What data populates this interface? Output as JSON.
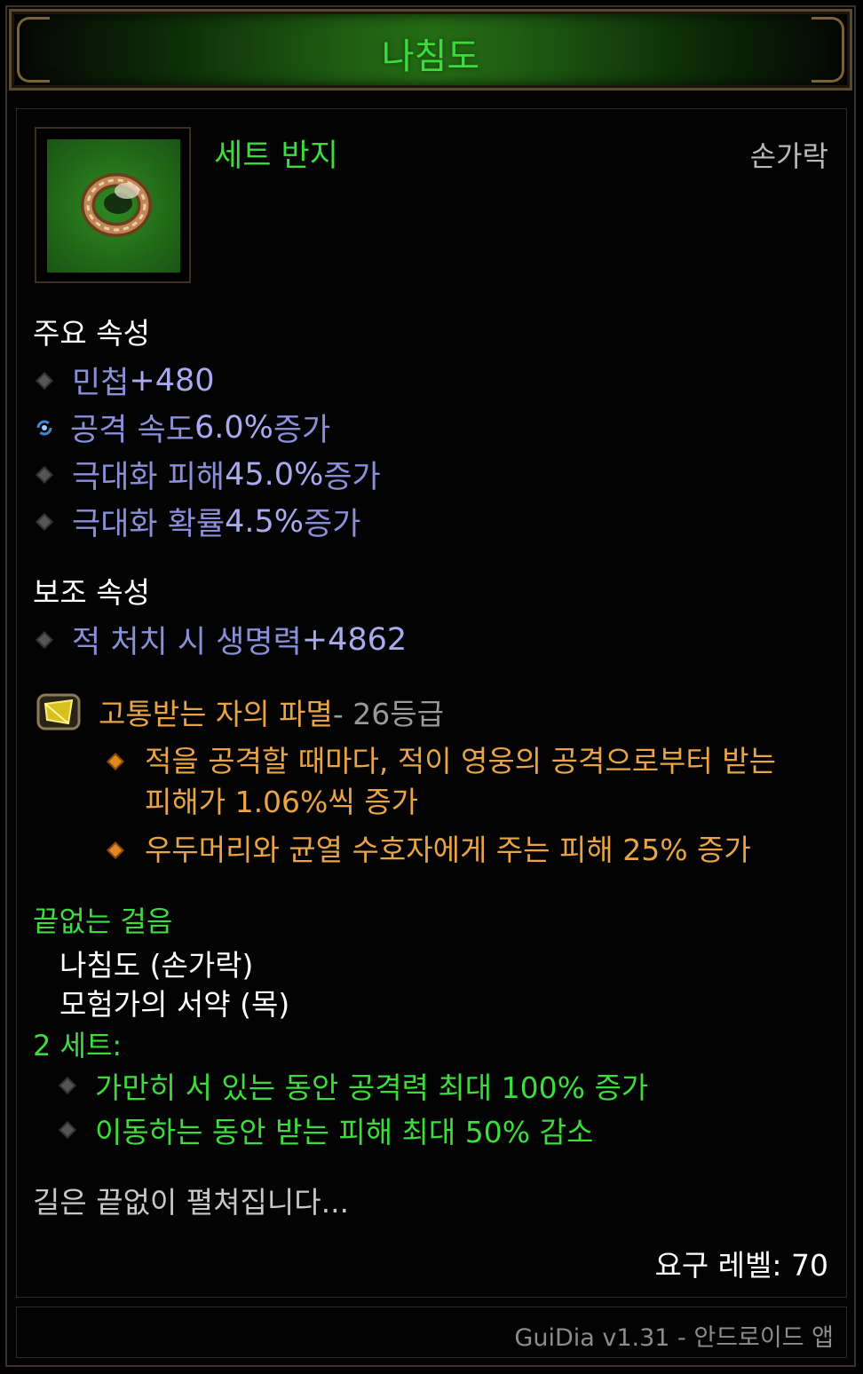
{
  "item": {
    "name": "나침도",
    "set_type": "세트 반지",
    "slot": "손가락"
  },
  "primary": {
    "title": "주요 속성",
    "props": [
      {
        "text": "민첩 ",
        "value": "+480",
        "icon": "diamond-bullet-icon"
      },
      {
        "text": "공격 속도 ",
        "value": "6.0%",
        "suffix": " 증가",
        "icon": "cycle-icon"
      },
      {
        "text": "극대화 피해 ",
        "value": "45.0%",
        "suffix": " 증가",
        "icon": "diamond-bullet-icon"
      },
      {
        "text": "극대화 확률 ",
        "value": "4.5%",
        "suffix": " 증가",
        "icon": "diamond-bullet-icon"
      }
    ]
  },
  "secondary": {
    "title": "보조 속성",
    "props": [
      {
        "text": "적 처치 시 생명력 ",
        "value": "+4862",
        "icon": "diamond-bullet-icon"
      }
    ]
  },
  "gem": {
    "name": "고통받는 자의 파멸",
    "rank": " - 26등급",
    "effects": [
      "적을 공격할 때마다, 적이 영웅의 공격으로부터 받는 피해가 1.06%씩 증가",
      "우두머리와 균열 수호자에게 주는 피해 25% 증가"
    ]
  },
  "set": {
    "name": "끝없는 걸음",
    "pieces": [
      "나침도 (손가락)",
      "모험가의 서약 (목)"
    ],
    "bonus_title": "2 세트:",
    "bonuses": [
      "가만히 서 있는 동안 공격력 최대 100% 증가",
      "이동하는 동안 받는 피해 최대 50% 감소"
    ]
  },
  "flavor": "길은 끝없이 펼쳐집니다...",
  "required_level": "요구 레벨: 70",
  "footer": "GuiDia v1.31 - 안드로이드 앱",
  "colors": {
    "set_green": "#3ddb3d",
    "magic_blue": "#8a8fd8",
    "legendary_orange": "#e8a445"
  }
}
